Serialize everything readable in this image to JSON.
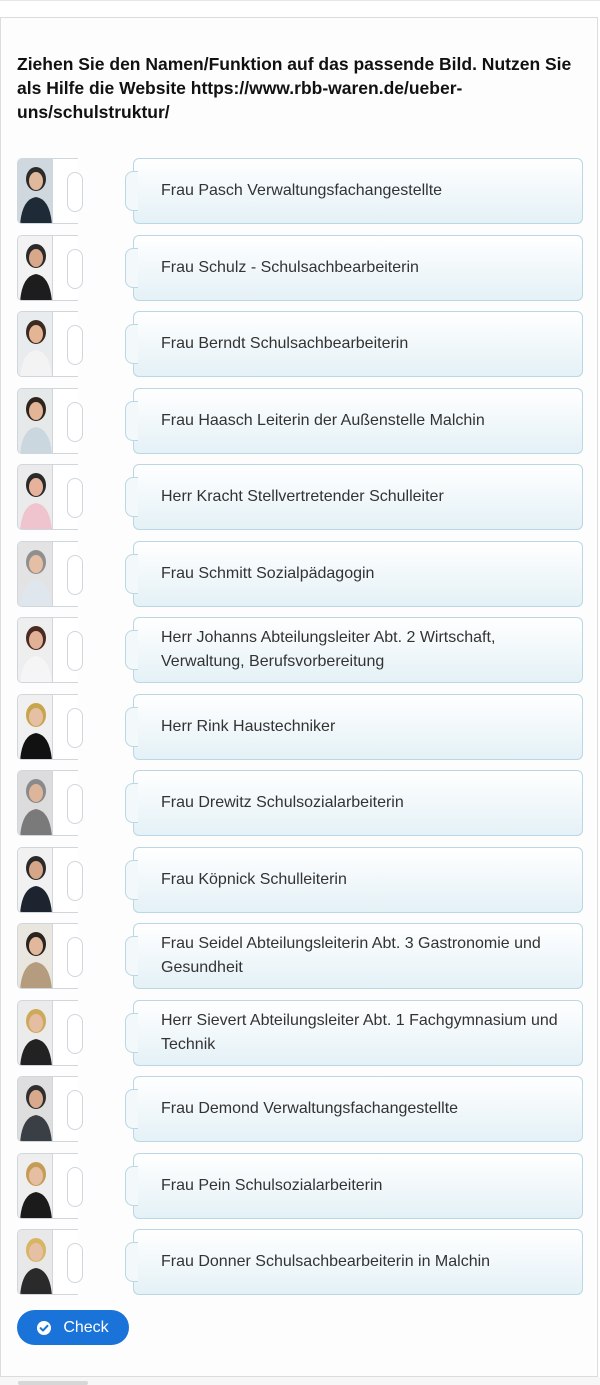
{
  "task": {
    "instruction": "Ziehen Sie den Namen/Funktion auf das passende Bild. Nutzen Sie als Hilfe die Website https://www.rbb-waren.de/ueber-uns/schulstruktur/"
  },
  "items": [
    {
      "label": "Frau Pasch Verwaltungsfachangestellte",
      "photo": "photo-woman-dark-hair"
    },
    {
      "label": "Frau Schulz - Schulsachbearbeiterin",
      "photo": "photo-man-suit"
    },
    {
      "label": "Frau Berndt Schulsachbearbeiterin",
      "photo": "photo-woman-white-top"
    },
    {
      "label": "Frau Haasch Leiterin der Außenstelle Malchin",
      "photo": "photo-woman-patterned"
    },
    {
      "label": "Herr Kracht Stellvertretender Schulleiter",
      "photo": "photo-woman-pink-jacket"
    },
    {
      "label": "Frau Schmitt Sozialpädagogin",
      "photo": "photo-woman-grey-hair"
    },
    {
      "label": "Herr Johanns Abteilungsleiter Abt. 2 Wirtschaft, Verwaltung, Berufsvorbereitung",
      "photo": "photo-woman-short-hair"
    },
    {
      "label": "Herr Rink Haustechniker",
      "photo": "photo-woman-blond-black"
    },
    {
      "label": "Frau Drewitz Schulsozialarbeiterin",
      "photo": "photo-man-grey"
    },
    {
      "label": "Frau Köpnick Schulleiterin",
      "photo": "photo-man-dark-suit"
    },
    {
      "label": "Frau Seidel Abteilungsleiterin Abt. 3 Gastronomie und Gesundheit",
      "photo": "photo-woman-beige-coat"
    },
    {
      "label": "Herr Sievert Abteilungsleiter Abt. 1 Fachgymnasium und Technik",
      "photo": "photo-woman-blond-scarf"
    },
    {
      "label": "Frau Demond Verwaltungsfachangestellte",
      "photo": "photo-man-grey-suit"
    },
    {
      "label": "Frau Pein Schulsozialarbeiterin",
      "photo": "photo-woman-blond-long"
    },
    {
      "label": "Frau Donner Schulsachbearbeiterin in Malchin",
      "photo": "photo-woman-blond-pattern"
    }
  ],
  "check_button": {
    "label": "Check",
    "icon": "check-circle-icon"
  },
  "colors": {
    "accent": "#1a73d9",
    "card_border": "#b9d7e4"
  }
}
